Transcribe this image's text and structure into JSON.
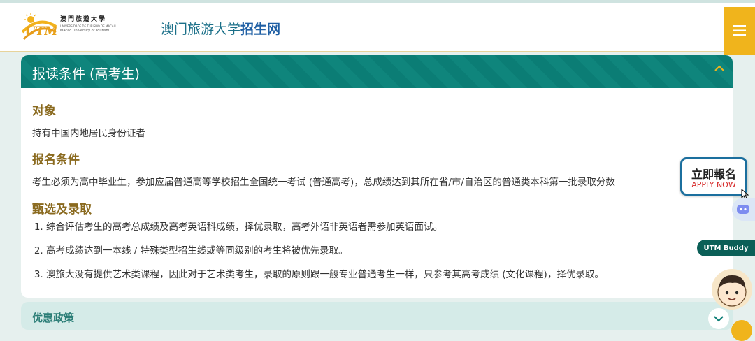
{
  "header": {
    "logo": {
      "mark": "UTM",
      "name_zh": "澳門旅遊大學",
      "name_pt": "UNIVERSIDADE DE TURISMO DE MACAU",
      "name_en": "Macao University of Tourism"
    },
    "title_plain": "澳门旅游大学",
    "title_bold": "招生网",
    "menu_icon": "hamburger-icon"
  },
  "section": {
    "title": "报读条件 (高考生)",
    "blocks": {
      "target_heading": "对象",
      "target_text": "持有中国内地居民身份证者",
      "requirement_heading": "报名条件",
      "requirement_text": "考生必须为高中毕业生，参加应届普通高等学校招生全国统一考试 (普通高考)，总成绩达到其所在省/市/自治区的普通类本科第一批录取分数",
      "selection_heading": "甄选及录取",
      "selection_items": [
        "综合评估考生的高考总成绩及高考英语科成绩，择优录取，高考外语非英语者需参加英语面试。",
        "高考成绩达到一本线 / 特殊类型招生线或等同级别的考生将被优先录取。",
        "澳旅大没有提供艺术类课程，因此对于艺术类考生，录取的原则跟一般专业普通考生一样，只参考其高考成绩 (文化课程)，择优录取。"
      ]
    }
  },
  "next_section": {
    "title": "优惠政策"
  },
  "apply_button": {
    "label_zh": "立即報名",
    "label_en": "APPLY NOW"
  },
  "chatbot": {
    "label": "UTM Buddy"
  },
  "colors": {
    "accent_teal": "#0b7d75",
    "accent_gold": "#f0b41c",
    "heading_brown": "#8a6a1f",
    "apply_border": "#1b6f9e",
    "apply_red": "#d62828"
  }
}
